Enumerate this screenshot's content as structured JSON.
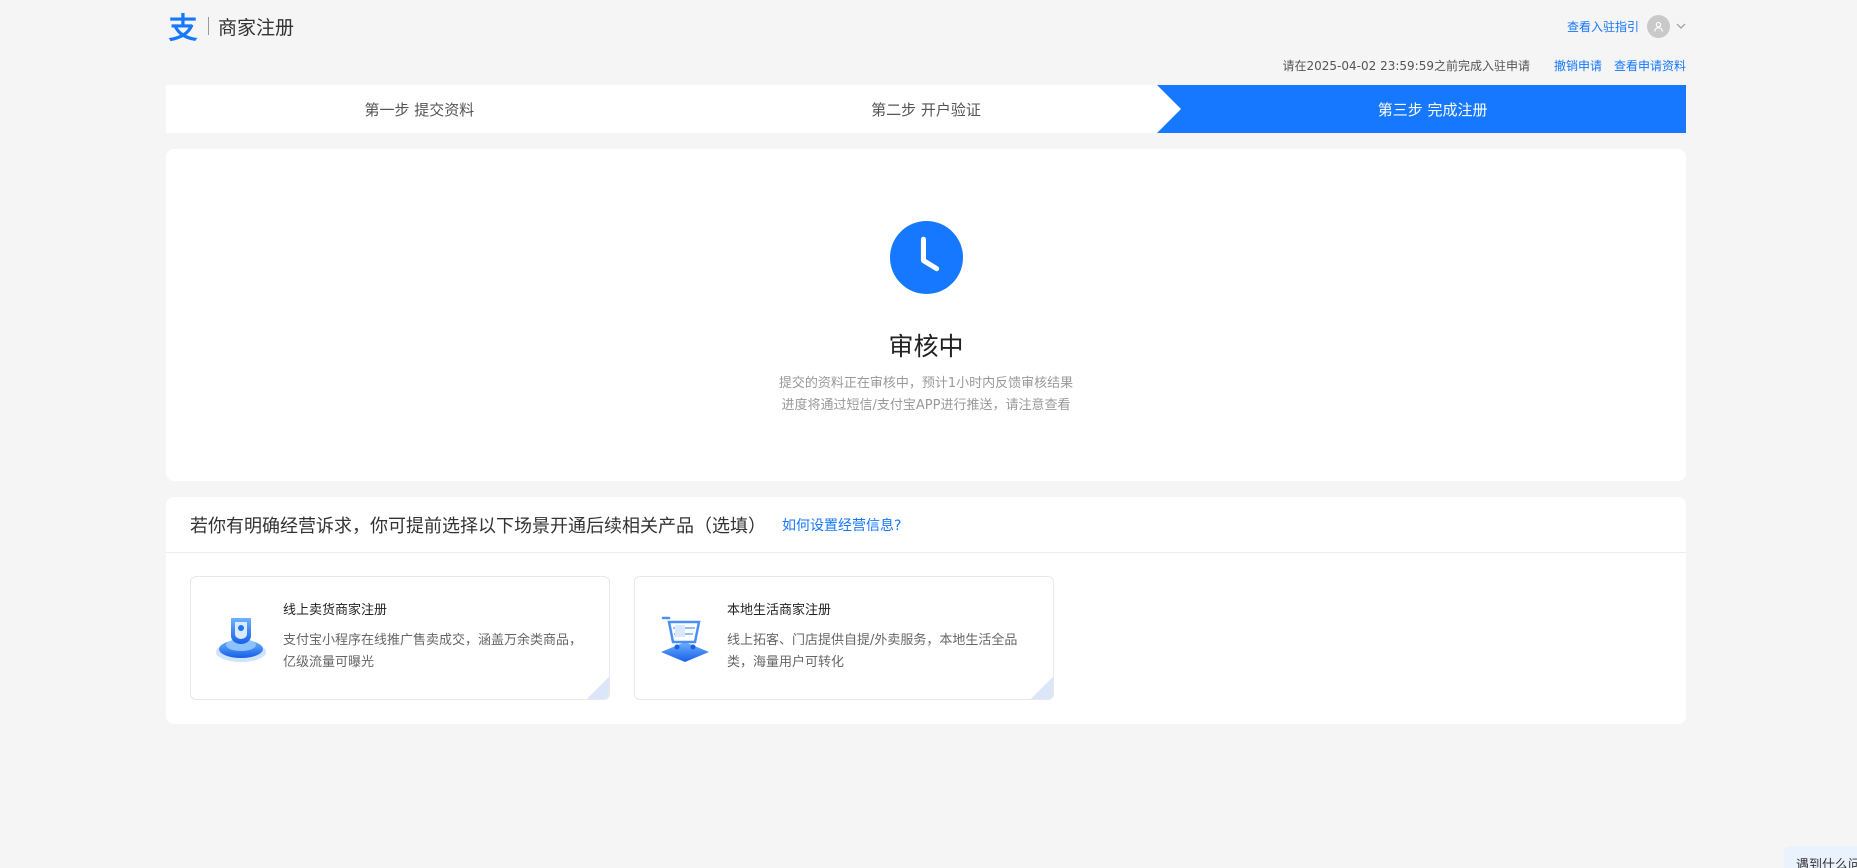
{
  "header": {
    "logo_glyph": "支",
    "title": "商家注册",
    "guide_link": "查看入驻指引"
  },
  "notice": {
    "deadline": "请在2025-04-02 23:59:59之前完成入驻申请",
    "cancel_link": "撤销申请",
    "view_link": "查看申请资料"
  },
  "steps": [
    {
      "label": "第一步 提交资料",
      "state": "done"
    },
    {
      "label": "第二步 开户验证",
      "state": "done"
    },
    {
      "label": "第三步 完成注册",
      "state": "active"
    }
  ],
  "status": {
    "icon": "clock-icon",
    "title": "审核中",
    "line1": "提交的资料正在审核中，预计1小时内反馈审核结果",
    "line2": "进度将通过短信/支付宝APP进行推送，请注意查看"
  },
  "scenes": {
    "title": "若你有明确经营诉求，你可提前选择以下场景开通后续相关产品（选填）",
    "help_link": "如何设置经营信息?",
    "products": [
      {
        "name": "线上卖货商家注册",
        "desc": "支付宝小程序在线推广售卖成交，涵盖万余类商品，亿级流量可曝光",
        "icon": "online-shop-icon"
      },
      {
        "name": "本地生活商家注册",
        "desc": "线上拓客、门店提供自提/外卖服务，本地生活全品类，海量用户可转化",
        "icon": "shopping-cart-icon"
      }
    ]
  },
  "float_widget": {
    "text": "遇到什么问题"
  },
  "colors": {
    "brand": "#1677ff",
    "background": "#f5f5f5"
  }
}
